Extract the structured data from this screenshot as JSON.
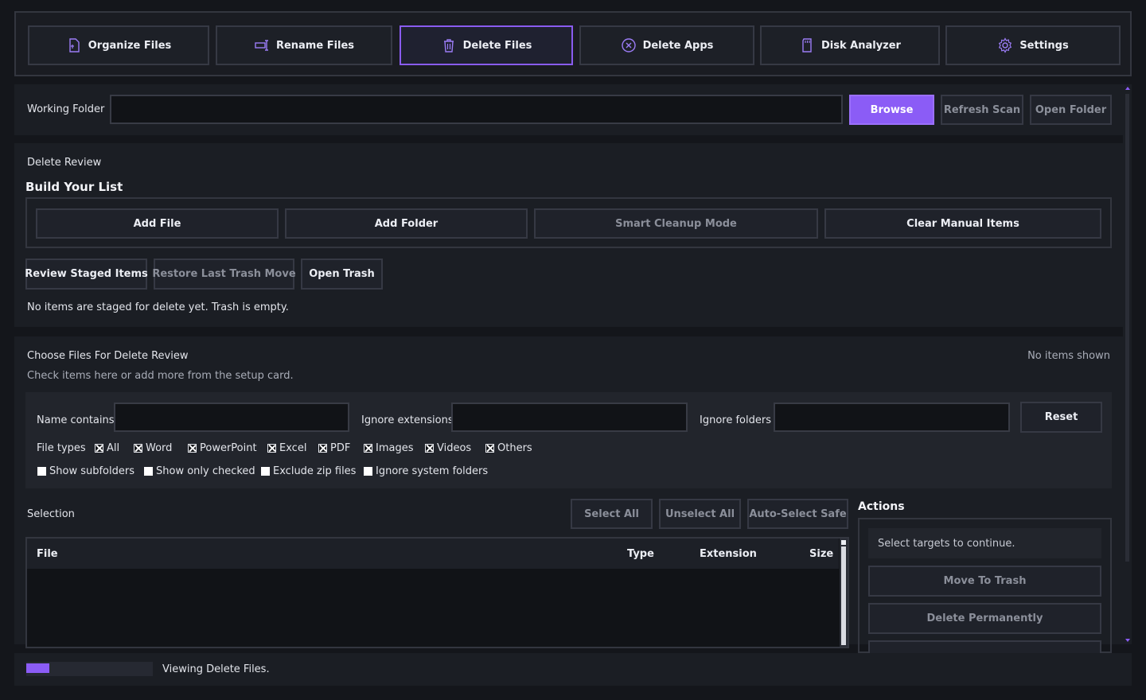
{
  "tabs": [
    {
      "label": "Organize Files",
      "icon": "folder-file-icon"
    },
    {
      "label": "Rename Files",
      "icon": "rename-icon"
    },
    {
      "label": "Delete Files",
      "icon": "trash-icon"
    },
    {
      "label": "Delete Apps",
      "icon": "circle-x-icon"
    },
    {
      "label": "Disk Analyzer",
      "icon": "sd-card-icon"
    },
    {
      "label": "Settings",
      "icon": "gear-icon"
    }
  ],
  "active_tab": "Delete Files",
  "accent_color": "#8b5cf6",
  "working_folder": {
    "label": "Working Folder",
    "value": "",
    "browse": "Browse",
    "refresh": "Refresh Scan",
    "open": "Open Folder"
  },
  "delete_review": {
    "section_label": "Delete Review",
    "heading": "Build Your List",
    "add_file": "Add File",
    "add_folder": "Add Folder",
    "smart_cleanup": "Smart Cleanup Mode",
    "clear_manual": "Clear Manual Items",
    "review_staged": "Review Staged Items",
    "restore_last": "Restore Last Trash Move",
    "open_trash": "Open Trash",
    "status": "No items are staged for delete yet. Trash is empty."
  },
  "choose": {
    "title": "Choose Files For Delete Review",
    "subtitle": "Check items here or add more from the setup card.",
    "count": "No items shown"
  },
  "filters": {
    "name_contains": "Name contains",
    "ignore_extensions": "Ignore extensions",
    "ignore_folders": "Ignore folders",
    "reset": "Reset",
    "file_types_label": "File types",
    "file_types": [
      {
        "label": "All",
        "checked": true
      },
      {
        "label": "Word",
        "checked": true
      },
      {
        "label": "PowerPoint",
        "checked": true
      },
      {
        "label": "Excel",
        "checked": true
      },
      {
        "label": "PDF",
        "checked": true
      },
      {
        "label": "Images",
        "checked": true
      },
      {
        "label": "Videos",
        "checked": true
      },
      {
        "label": "Others",
        "checked": true
      }
    ],
    "options": [
      {
        "label": "Show subfolders",
        "checked": false
      },
      {
        "label": "Show only checked",
        "checked": false
      },
      {
        "label": "Exclude zip files",
        "checked": false
      },
      {
        "label": "Ignore system folders",
        "checked": false
      }
    ]
  },
  "selection": {
    "label": "Selection",
    "select_all": "Select All",
    "unselect_all": "Unselect All",
    "auto_select": "Auto-Select Safe",
    "columns": [
      "File",
      "Type",
      "Extension",
      "Size"
    ],
    "rows": []
  },
  "actions": {
    "heading": "Actions",
    "hint": "Select targets to continue.",
    "move_to_trash": "Move To Trash",
    "delete_permanently": "Delete Permanently"
  },
  "status_bar": {
    "progress": 0.18,
    "text": "Viewing Delete Files."
  }
}
